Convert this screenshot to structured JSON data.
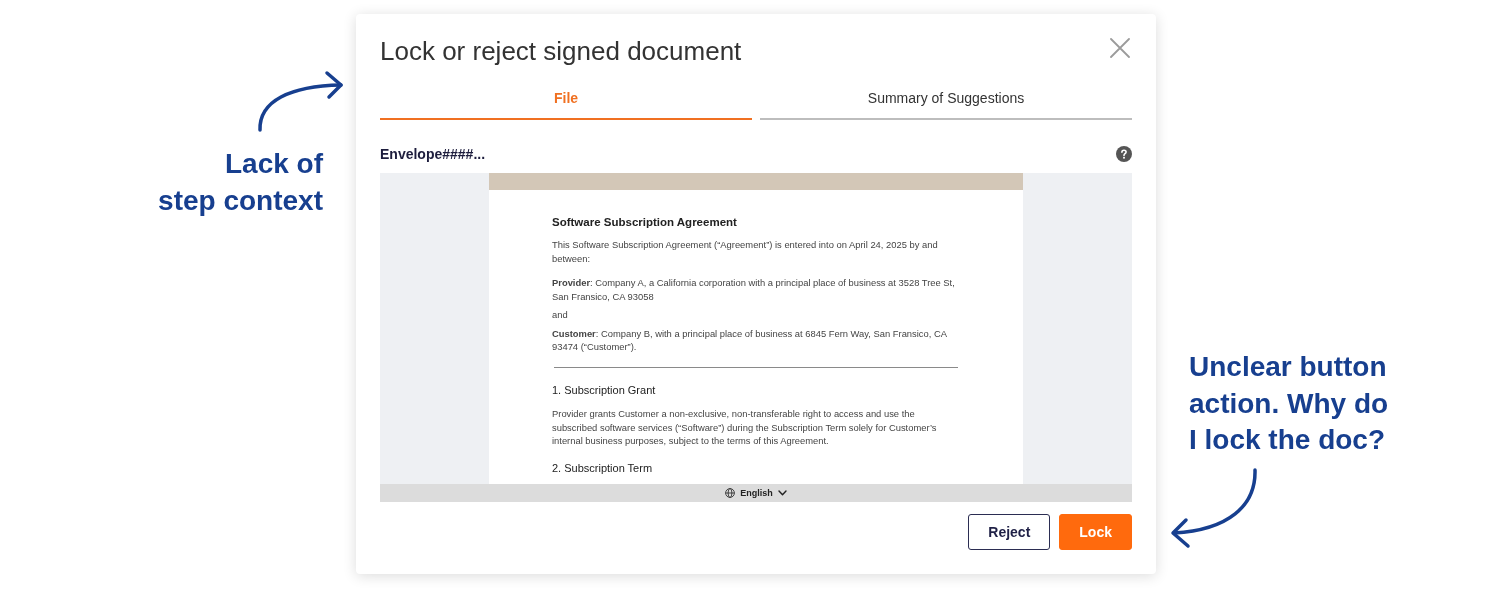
{
  "left_annotation": {
    "text": "Lack of\nstep context"
  },
  "dialog": {
    "title": "Lock or reject signed document",
    "tabs": [
      {
        "label": "File",
        "selected": true
      },
      {
        "label": "Summary of Suggestions",
        "selected": false
      }
    ],
    "file_name": "Envelope####...",
    "document": {
      "title": "Software Subscription Agreement",
      "blocks": [
        {
          "kind": "paragraph",
          "text": "This Software Subscription Agreement (“Agreement”) is entered into on April 24, 2025 by and between:"
        },
        {
          "kind": "paragraph",
          "text": "**Provider**: Company A, a California corporation with a principal place of business at 3528 Tree St, San Fransico, CA 93058"
        },
        {
          "kind": "paragraph",
          "text": "and"
        },
        {
          "kind": "paragraph",
          "text": "**Customer**: Company B, with a principal place of business at 6845 Fern Way, San Fransico, CA 93474 (“Customer”)."
        },
        {
          "kind": "rule"
        },
        {
          "kind": "heading",
          "text": "1. Subscription Grant"
        },
        {
          "kind": "paragraph",
          "text": "Provider grants Customer a non-exclusive, non-transferable right to access and use the subscribed software services (“Software”) during the Subscription Term solely for Customer’s internal business purposes, subject to the terms of this Agreement."
        },
        {
          "kind": "heading",
          "text": "2. Subscription Term"
        }
      ]
    },
    "language": "English",
    "buttons": [
      {
        "label": "Reject",
        "kind": "secondary"
      },
      {
        "label": "Lock",
        "kind": "primary"
      }
    ]
  },
  "right_annotation": {
    "text": "Unclear button\naction. Why do\nI lock the doc?"
  }
}
